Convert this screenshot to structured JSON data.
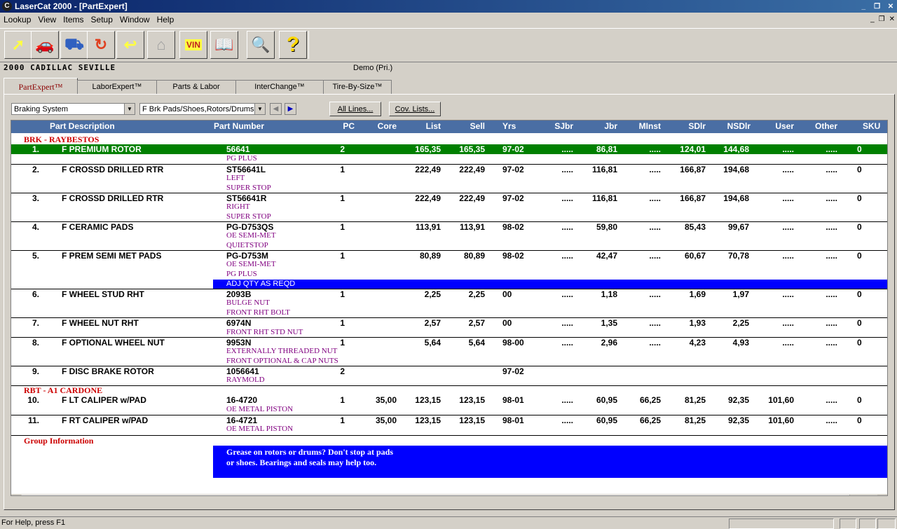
{
  "window": {
    "title": "LaserCat 2000 - [PartExpert]",
    "min": "_",
    "restore": "❐",
    "close": "✕"
  },
  "menu": [
    "Lookup",
    "View",
    "Items",
    "Setup",
    "Window",
    "Help"
  ],
  "mdi_controls": [
    "_",
    "❐",
    "✕"
  ],
  "toolbar": [
    {
      "name": "lookup-button",
      "icon": "arrow-icon",
      "glyph": "➚",
      "color": "#ffff40"
    },
    {
      "name": "vehicle-button",
      "icon": "car-icon",
      "glyph": "🚗",
      "color": "#ffd700"
    },
    {
      "name": "pickup-button",
      "icon": "truck-icon",
      "glyph": "⛟",
      "color": "#3060c0"
    },
    {
      "name": "refresh-button",
      "icon": "cycle-icon",
      "glyph": "↻",
      "color": "#e04020"
    },
    {
      "name": "return-button",
      "icon": "back-arrow-icon",
      "glyph": "↩",
      "color": "#ffff40"
    },
    {
      "name": "home-button",
      "icon": "house-icon",
      "glyph": "⌂",
      "color": "#a0a0a0"
    },
    {
      "name": "vin-button",
      "icon": "vin-car-icon",
      "glyph": "VIN",
      "color": "#c02020"
    },
    {
      "name": "catalog-button",
      "icon": "book-icon",
      "glyph": "📖",
      "color": "#ffff40"
    },
    {
      "name": "search-button",
      "icon": "magnifier-icon",
      "glyph": "🔍",
      "color": "#d00000"
    },
    {
      "name": "help-button",
      "icon": "question-icon",
      "glyph": "?",
      "color": "#ffd700"
    }
  ],
  "vehicle": "2000  CADILLAC  SEVILLE",
  "account": "Demo (Pri.)",
  "tabs": [
    "PartExpert™",
    "LaborExpert™",
    "Parts & Labor",
    "InterChange™",
    "Tire-By-Size™"
  ],
  "filters": {
    "system": "Braking System",
    "group": "F Brk Pads/Shoes,Rotors/Drums"
  },
  "buttons": {
    "all_lines": "All Lines...",
    "cov_lists": "Cov. Lists..."
  },
  "columns": [
    "Part Description",
    "Part Number",
    "PC",
    "Core",
    "List",
    "Sell",
    "Yrs",
    "SJbr",
    "Jbr",
    "MInst",
    "SDlr",
    "NSDlr",
    "User",
    "Other",
    "SKU"
  ],
  "groups": [
    {
      "name": "BRK - RAYBESTOS",
      "rows": [
        {
          "num": "1.",
          "desc": "F PREMIUM ROTOR",
          "part": "56641",
          "pc": "2",
          "core": "",
          "list": "165,35",
          "sell": "165,35",
          "yrs": "97-02",
          "sjbr": ".....",
          "jbr": "86,81",
          "minst": ".....",
          "sdlr": "124,01",
          "nsdlr": "144,68",
          "user": ".....",
          "other": ".....",
          "sku": "0",
          "notes": [
            "PG PLUS"
          ],
          "selected": true
        },
        {
          "num": "2.",
          "desc": "F CROSSD DRILLED RTR",
          "part": "ST56641L",
          "pc": "1",
          "core": "",
          "list": "222,49",
          "sell": "222,49",
          "yrs": "97-02",
          "sjbr": ".....",
          "jbr": "116,81",
          "minst": ".....",
          "sdlr": "166,87",
          "nsdlr": "194,68",
          "user": ".....",
          "other": ".....",
          "sku": "0",
          "notes": [
            "LEFT",
            "SUPER STOP"
          ]
        },
        {
          "num": "3.",
          "desc": "F CROSSD DRILLED RTR",
          "part": "ST56641R",
          "pc": "1",
          "core": "",
          "list": "222,49",
          "sell": "222,49",
          "yrs": "97-02",
          "sjbr": ".....",
          "jbr": "116,81",
          "minst": ".....",
          "sdlr": "166,87",
          "nsdlr": "194,68",
          "user": ".....",
          "other": ".....",
          "sku": "0",
          "notes": [
            "RIGHT",
            "SUPER STOP"
          ]
        },
        {
          "num": "4.",
          "desc": "F CERAMIC PADS",
          "part": "PG-D753QS",
          "pc": "1",
          "core": "",
          "list": "113,91",
          "sell": "113,91",
          "yrs": "98-02",
          "sjbr": ".....",
          "jbr": "59,80",
          "minst": ".....",
          "sdlr": "85,43",
          "nsdlr": "99,67",
          "user": ".....",
          "other": ".....",
          "sku": "0",
          "notes": [
            "OE SEMI-MET",
            "QUIETSTOP"
          ]
        },
        {
          "num": "5.",
          "desc": "F PREM SEMI MET PADS",
          "part": "PG-D753M",
          "pc": "1",
          "core": "",
          "list": "80,89",
          "sell": "80,89",
          "yrs": "98-02",
          "sjbr": ".....",
          "jbr": "42,47",
          "minst": ".....",
          "sdlr": "60,67",
          "nsdlr": "70,78",
          "user": ".....",
          "other": ".....",
          "sku": "0",
          "notes": [
            "OE SEMI-MET",
            "PG PLUS"
          ],
          "banner": "ADJ QTY AS REQD"
        },
        {
          "num": "6.",
          "desc": "F WHEEL STUD RHT",
          "part": "2093B",
          "pc": "1",
          "core": "",
          "list": "2,25",
          "sell": "2,25",
          "yrs": "00",
          "sjbr": ".....",
          "jbr": "1,18",
          "minst": ".....",
          "sdlr": "1,69",
          "nsdlr": "1,97",
          "user": ".....",
          "other": ".....",
          "sku": "0",
          "notes": [
            "BULGE NUT",
            "FRONT RHT BOLT"
          ]
        },
        {
          "num": "7.",
          "desc": "F WHEEL NUT RHT",
          "part": "6974N",
          "pc": "1",
          "core": "",
          "list": "2,57",
          "sell": "2,57",
          "yrs": "00",
          "sjbr": ".....",
          "jbr": "1,35",
          "minst": ".....",
          "sdlr": "1,93",
          "nsdlr": "2,25",
          "user": ".....",
          "other": ".....",
          "sku": "0",
          "notes": [
            "FRONT RHT STD NUT"
          ]
        },
        {
          "num": "8.",
          "desc": "F OPTIONAL WHEEL NUT",
          "part": "9953N",
          "pc": "1",
          "core": "",
          "list": "5,64",
          "sell": "5,64",
          "yrs": "98-00",
          "sjbr": ".....",
          "jbr": "2,96",
          "minst": ".....",
          "sdlr": "4,23",
          "nsdlr": "4,93",
          "user": ".....",
          "other": ".....",
          "sku": "0",
          "notes": [
            "EXTERNALLY THREADED NUT",
            "FRONT OPTIONAL & CAP NUTS"
          ]
        },
        {
          "num": "9.",
          "desc": "F DISC BRAKE ROTOR",
          "part": "1056641",
          "pc": "2",
          "core": "",
          "list": "",
          "sell": "",
          "yrs": "97-02",
          "sjbr": "",
          "jbr": "",
          "minst": "",
          "sdlr": "",
          "nsdlr": "",
          "user": "",
          "other": "",
          "sku": "",
          "notes": [
            "RAYMOLD"
          ]
        }
      ]
    },
    {
      "name": "RBT - A1 CARDONE",
      "rows": [
        {
          "num": "10.",
          "desc": "F LT CALIPER w/PAD",
          "part": "16-4720",
          "pc": "1",
          "core": "35,00",
          "list": "123,15",
          "sell": "123,15",
          "yrs": "98-01",
          "sjbr": ".....",
          "jbr": "60,95",
          "minst": "66,25",
          "sdlr": "81,25",
          "nsdlr": "92,35",
          "user": "101,60",
          "other": ".....",
          "sku": "0",
          "notes": [
            "OE METAL PISTON"
          ]
        },
        {
          "num": "11.",
          "desc": "F RT CALIPER w/PAD",
          "part": "16-4721",
          "pc": "1",
          "core": "35,00",
          "list": "123,15",
          "sell": "123,15",
          "yrs": "98-01",
          "sjbr": ".....",
          "jbr": "60,95",
          "minst": "66,25",
          "sdlr": "81,25",
          "nsdlr": "92,35",
          "user": "101,60",
          "other": ".....",
          "sku": "0",
          "notes": [
            "OE METAL PISTON"
          ]
        }
      ]
    }
  ],
  "group_info": {
    "title": "Group Information",
    "lines": [
      "Grease on rotors or drums? Don't stop at pads",
      "or shoes. Bearings and seals may help too."
    ]
  },
  "status": "For Help, press F1"
}
